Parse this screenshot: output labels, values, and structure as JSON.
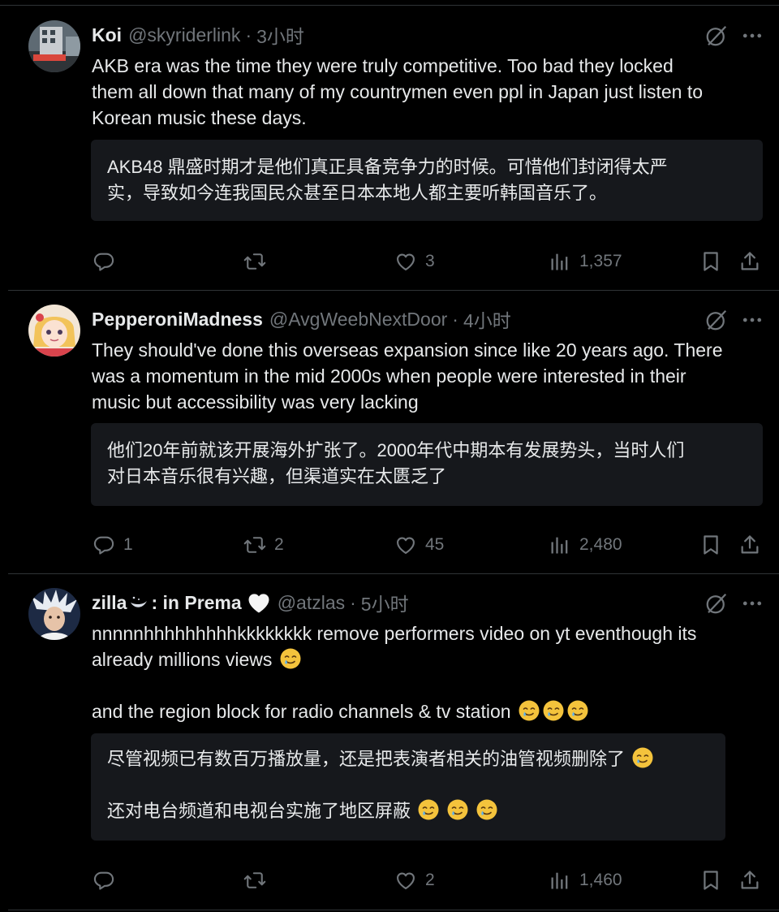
{
  "posts": [
    {
      "name": "Koi",
      "handle": "@skyriderlink",
      "separator": "·",
      "time": "3小时",
      "text_lines": [
        "AKB era was the time they were truly competitive. Too bad they locked",
        "them all down that many of my countrymen even ppl in Japan just listen to",
        "Korean music these days."
      ],
      "translation_lines": [
        "AKB48 鼎盛时期才是他们真正具备竞争力的时候。可惜他们封闭得太严",
        "实，导致如今连我国民众甚至日本本地人都主要听韩国音乐了。"
      ],
      "stats": {
        "replies": "",
        "reposts": "",
        "likes": "3",
        "views": "1,357"
      }
    },
    {
      "name": "PepperoniMadness",
      "handle": "@AvgWeebNextDoor",
      "separator": "·",
      "time": "4小时",
      "text_lines": [
        "They should've done this overseas expansion since like 20 years ago. There",
        "was a momentum in the mid 2000s when people were interested in their",
        "music but accessibility was very lacking"
      ],
      "translation_lines": [
        "他们20年前就该开展海外扩张了。2000年代中期本有发展势头，当时人们",
        "对日本音乐很有兴趣，但渠道实在太匮乏了"
      ],
      "stats": {
        "replies": "1",
        "reposts": "2",
        "likes": "45",
        "views": "2,480"
      }
    },
    {
      "name": "zilla",
      "name_suffix": ": in Prema",
      "handle": "@atzlas",
      "separator": "·",
      "time": "5小时",
      "text_line1": "nnnnnhhhhhhhhhkkkkkkkk remove performers video on yt eventhough its",
      "text_line2": "already millions views",
      "text_line3": "and the region block for radio channels & tv station",
      "translation_line1": "尽管视频已有数百万播放量，还是把表演者相关的油管视频删除了",
      "translation_line2": "还对电台频道和电视台实施了地区屏蔽",
      "stats": {
        "replies": "",
        "reposts": "",
        "likes": "2",
        "views": "1,460"
      }
    }
  ],
  "icons": {
    "reply": "reply-icon",
    "repost": "repost-icon",
    "like": "heart-icon",
    "views": "views-icon",
    "bookmark": "bookmark-icon",
    "share": "share-icon",
    "grok": "grok-icon",
    "more": "more-icon",
    "emoji": "crying-smile-emoji",
    "heart_emoji": "white-heart-emoji"
  },
  "colors": {
    "background": "#000000",
    "text": "#e7e9ea",
    "muted": "#71767b",
    "divider": "#2f3336",
    "translation_bg": "#16181c"
  }
}
